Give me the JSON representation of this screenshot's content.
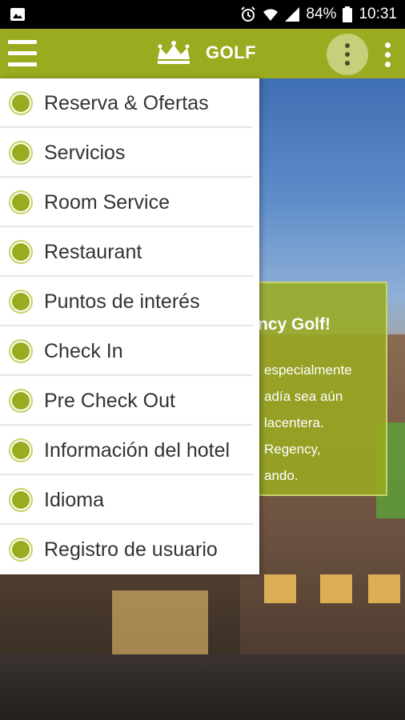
{
  "status_bar": {
    "battery": "84%",
    "time": "10:31"
  },
  "app_bar": {
    "brand": "GOLF"
  },
  "menu": {
    "items": [
      {
        "label": "Reserva & Ofertas"
      },
      {
        "label": "Servicios"
      },
      {
        "label": "Room Service"
      },
      {
        "label": "Restaurant"
      },
      {
        "label": "Puntos de interés"
      },
      {
        "label": "Check In"
      },
      {
        "label": "Pre Check Out"
      },
      {
        "label": "Información del hotel"
      },
      {
        "label": "Idioma"
      },
      {
        "label": "Registro de usuario"
      }
    ]
  },
  "welcome_card": {
    "title": "ncy Golf!",
    "text": "especialmente\nadía sea aún\nlacentera.\nRegency,\nando."
  },
  "colors": {
    "accent": "#9aab1f",
    "accent_light": "#c7cf7a"
  }
}
